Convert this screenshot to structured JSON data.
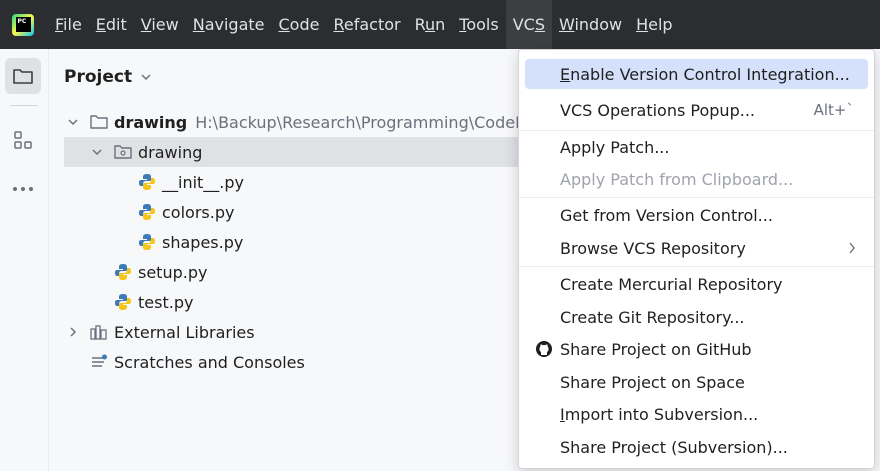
{
  "menubar": {
    "logo_text": "PC",
    "items": [
      {
        "pre": "",
        "mn": "F",
        "post": "ile"
      },
      {
        "pre": "",
        "mn": "E",
        "post": "dit"
      },
      {
        "pre": "",
        "mn": "V",
        "post": "iew"
      },
      {
        "pre": "",
        "mn": "N",
        "post": "avigate"
      },
      {
        "pre": "",
        "mn": "C",
        "post": "ode"
      },
      {
        "pre": "",
        "mn": "R",
        "post": "efactor"
      },
      {
        "pre": "R",
        "mn": "u",
        "post": "n"
      },
      {
        "pre": "",
        "mn": "T",
        "post": "ools"
      },
      {
        "pre": "VC",
        "mn": "S",
        "post": ""
      },
      {
        "pre": "",
        "mn": "W",
        "post": "indow"
      },
      {
        "pre": "",
        "mn": "H",
        "post": "elp"
      }
    ]
  },
  "project_panel": {
    "title": "Project",
    "tree": [
      {
        "label": "drawing",
        "path": "H:\\Backup\\Research\\Programming\\CodePy"
      },
      {
        "label": "drawing"
      },
      {
        "label": "__init__.py"
      },
      {
        "label": "colors.py"
      },
      {
        "label": "shapes.py"
      },
      {
        "label": "setup.py"
      },
      {
        "label": "test.py"
      },
      {
        "label": "External Libraries"
      },
      {
        "label": "Scratches and Consoles"
      }
    ]
  },
  "vcs_menu": {
    "items": [
      {
        "pre": "",
        "mn": "E",
        "post": "nable Version Control Integration..."
      },
      {
        "pre": "VCS Operations Popup...",
        "mn": "",
        "post": "",
        "shortcut": "Alt+`"
      },
      {
        "pre": "Apply Patch...",
        "mn": "",
        "post": ""
      },
      {
        "pre": "Apply Patch from Clipboard...",
        "mn": "",
        "post": ""
      },
      {
        "pre": "Get from Version Control...",
        "mn": "",
        "post": ""
      },
      {
        "pre": "Browse VCS Repository",
        "mn": "",
        "post": ""
      },
      {
        "pre": "Create Mercurial Repository",
        "mn": "",
        "post": ""
      },
      {
        "pre": "Create Git Repository...",
        "mn": "",
        "post": ""
      },
      {
        "pre": "Share Project on GitHub",
        "mn": "",
        "post": ""
      },
      {
        "pre": "Share Project on Space",
        "mn": "",
        "post": ""
      },
      {
        "pre": "",
        "mn": "I",
        "post": "mport into Subversion..."
      },
      {
        "pre": "Share Project (Subversion)...",
        "mn": "",
        "post": ""
      }
    ]
  },
  "colors": {
    "menubar_bg": "#2b2d30",
    "highlight": "#d5e1fb",
    "selection": "#dfe1e5",
    "python_blue": "#3d7ab8",
    "python_yellow": "#f5c518"
  }
}
